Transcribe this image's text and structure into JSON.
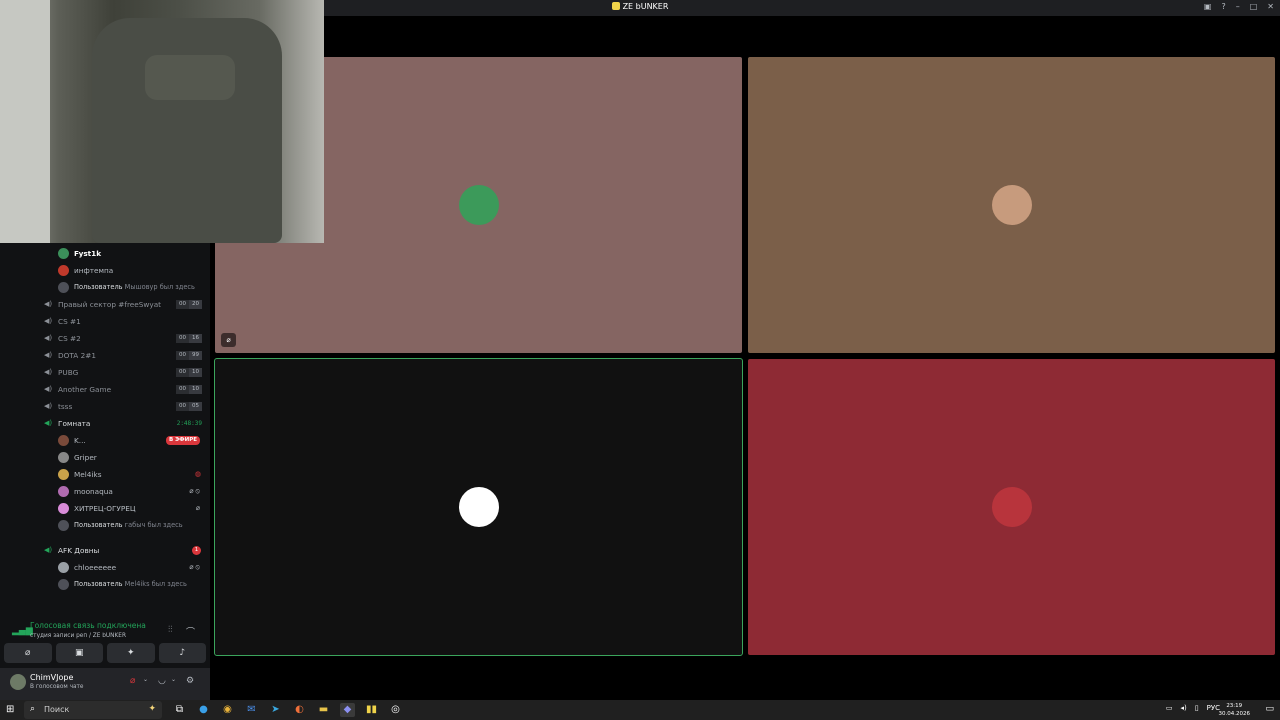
{
  "window": {
    "title": "ZE bUNKER"
  },
  "tree": [
    {
      "kind": "user",
      "name": "Fyst1k",
      "self": true,
      "color": "#3b8f5a"
    },
    {
      "kind": "user",
      "name": "инфтемпа",
      "color": "#c0392b"
    },
    {
      "kind": "ghost",
      "who": "Пользователь",
      "rest": "Мышовур был здесь"
    },
    {
      "kind": "channel",
      "name": "Правый сектор #freeSwyat",
      "count": [
        "00",
        "20"
      ]
    },
    {
      "kind": "channel",
      "name": "CS #1"
    },
    {
      "kind": "channel",
      "name": "CS #2",
      "count": [
        "00",
        "16"
      ]
    },
    {
      "kind": "channel",
      "name": "DOTA 2#1",
      "count": [
        "00",
        "99"
      ]
    },
    {
      "kind": "channel",
      "name": "PUBG",
      "count": [
        "00",
        "10"
      ]
    },
    {
      "kind": "channel",
      "name": "Another Game",
      "count": [
        "00",
        "10"
      ]
    },
    {
      "kind": "channel",
      "name": "tsss",
      "count": [
        "00",
        "05"
      ]
    },
    {
      "kind": "channel",
      "name": "Гомната",
      "active": true,
      "timer": "2:48:39"
    },
    {
      "kind": "user",
      "name": "K...",
      "color": "#7a4a3a",
      "live": "В ЭФИРЕ"
    },
    {
      "kind": "user",
      "name": "Griper",
      "color": "#888888"
    },
    {
      "kind": "user",
      "name": "Mel4iks",
      "color": "#c9a24a",
      "redicon": "◍"
    },
    {
      "kind": "user",
      "name": "moonaqua",
      "color": "#b06bb0",
      "icons": "⌀⦸"
    },
    {
      "kind": "user",
      "name": "ХИТРЕЦ-ОГУРЕЦ",
      "color": "#d88bd8",
      "icons": "⌀"
    },
    {
      "kind": "ghost",
      "who": "Пользователь",
      "rest": "габыч был здесь"
    },
    {
      "kind": "spacer"
    },
    {
      "kind": "channel",
      "name": "AFK Довны",
      "active": true,
      "badge": "1"
    },
    {
      "kind": "user",
      "name": "chloeeeeee",
      "color": "#9aa0a6",
      "icons": "⌀⦸"
    },
    {
      "kind": "ghost",
      "who": "Пользователь",
      "rest": "Mel4iks был здесь"
    }
  ],
  "voice": {
    "status": "Голосовая связь подключена",
    "location": "студия записи реп / ZE bUNKER"
  },
  "user_panel": {
    "name": "ChimVJope",
    "status": "В голосовом чате"
  },
  "tiles": [
    {
      "label": "tile-1",
      "bg": "#856562",
      "avatar_color": "#3c9a5a"
    },
    {
      "label": "tile-2",
      "bg": "#7b5f49",
      "avatar_color": "#c79b7d"
    },
    {
      "label": "tile-3",
      "bg": "#111111",
      "avatar_color": "#ffffff"
    },
    {
      "label": "tile-4",
      "bg": "#8e2a34",
      "avatar_color": "#b8343c"
    }
  ],
  "taskbar": {
    "search_placeholder": "Поиск",
    "lang": "РУС",
    "time": "23:19",
    "date": "30.04.2026"
  },
  "icons": {
    "speaker": "🔊",
    "mute": "⌀",
    "signal": "▚",
    "hangup": "☎",
    "headphones": "🎧",
    "gear": "⚙",
    "windows": "⊞",
    "search": "⌕",
    "notify": "▭"
  }
}
